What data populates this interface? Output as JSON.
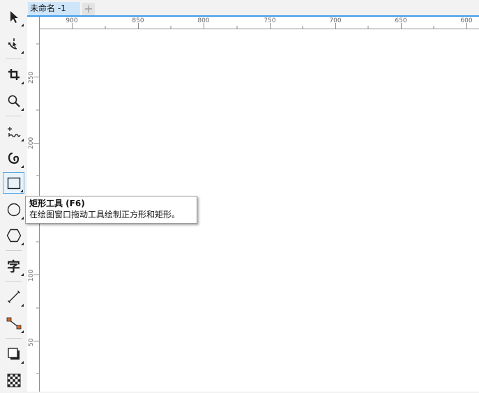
{
  "document": {
    "tab_title": "未命名 -1",
    "new_tab_symbol": "+"
  },
  "colors": {
    "accent": "#3d9be9",
    "active_tool_border": "#5aa9e6",
    "tab_background": "#cfe6fa",
    "canvas": "#ffffff"
  },
  "toolbox": [
    {
      "id": "pick",
      "icon": "pointer-arrow-icon"
    },
    {
      "id": "shape",
      "icon": "shape-node-icon"
    },
    {
      "id": "crop",
      "icon": "crop-icon"
    },
    {
      "id": "zoom",
      "icon": "magnifier-icon"
    },
    {
      "id": "freehand",
      "icon": "freehand-curve-icon"
    },
    {
      "id": "artistic-media",
      "icon": "artistic-media-icon"
    },
    {
      "id": "rectangle",
      "icon": "rectangle-icon",
      "active": true
    },
    {
      "id": "ellipse",
      "icon": "ellipse-icon"
    },
    {
      "id": "polygon",
      "icon": "polygon-icon"
    },
    {
      "id": "text",
      "icon": "text-char-icon",
      "glyph": "字"
    },
    {
      "id": "dimension",
      "icon": "parallel-dimension-icon"
    },
    {
      "id": "connector",
      "icon": "connector-icon"
    },
    {
      "id": "drop-shadow",
      "icon": "drop-shadow-icon"
    },
    {
      "id": "transparency",
      "icon": "transparency-checker-icon"
    }
  ],
  "rulers": {
    "horizontal_labels": [
      "900",
      "850",
      "800",
      "750",
      "700",
      "650",
      "600"
    ],
    "vertical_labels": [
      "250",
      "200",
      "100",
      "50"
    ]
  },
  "tooltip": {
    "title": "矩形工具 (F6)",
    "description": "在绘图窗口拖动工具绘制正方形和矩形。"
  }
}
